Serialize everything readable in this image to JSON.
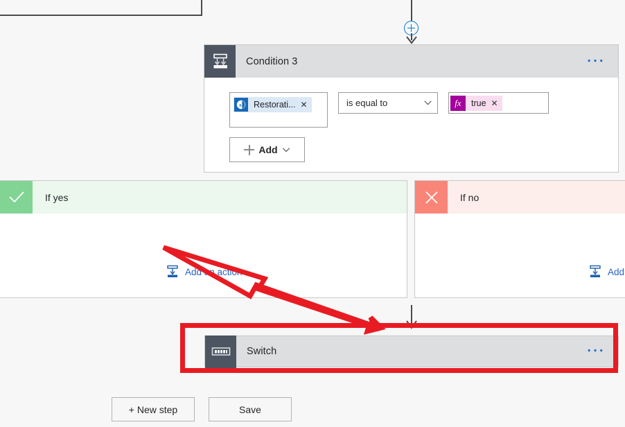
{
  "flow": {
    "condition": {
      "title": "Condition 3",
      "icon": "condition-icon",
      "menu_label": "···",
      "left_operand": {
        "icon": "sharepoint-icon",
        "icon_letter": "s",
        "label": "Restorati...",
        "remove_label": "✕"
      },
      "operator": {
        "value": "is equal to",
        "chevron": "chevron-down-icon"
      },
      "right_operand": {
        "icon": "expression-fx-icon",
        "icon_letter": "fx",
        "label": "true",
        "remove_label": "✕"
      },
      "add_button": {
        "label": "Add",
        "chevron": "chevron-down-icon"
      }
    },
    "branches": [
      {
        "id": "if-yes",
        "label": "If yes",
        "badge_icon": "checkmark-icon",
        "add_action_label": "Add an action",
        "add_action_icon": "add-action-icon"
      },
      {
        "id": "if-no",
        "label": "If no",
        "badge_icon": "cross-icon",
        "add_action_label": "Add ",
        "add_action_icon": "add-action-icon"
      }
    ],
    "switch_card": {
      "title": "Switch",
      "icon": "switch-icon",
      "menu_label": "···"
    },
    "toolbar": {
      "new_step_label": "+ New step",
      "save_label": "Save"
    },
    "connectors": {
      "insert_step_icon": "plus-circle-icon"
    }
  },
  "annotations": {
    "highlight_box": "red-rectangle-highlight",
    "pointer": "red-arrow-pointer",
    "color": "#e81b23"
  },
  "colors": {
    "header_gray": "#dcdee0",
    "icon_tile": "#4c5561",
    "link_blue": "#2763c6",
    "accent_blue": "#0078d4",
    "yes_green": "#81d493",
    "yes_bg": "#ecf7ee",
    "no_red": "#f98578",
    "no_bg": "#fdeeeb",
    "sharepoint_blue": "#1668b8",
    "expression_magenta": "#a4009b"
  }
}
